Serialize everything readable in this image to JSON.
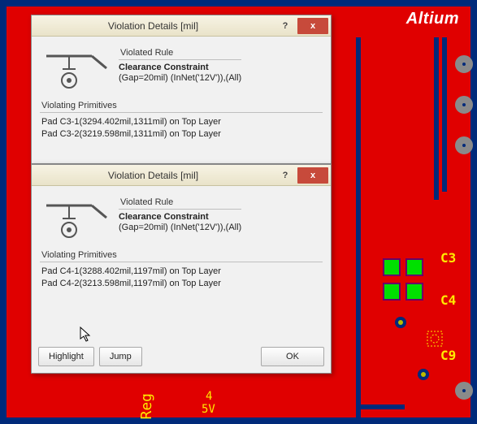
{
  "brand": "Altium",
  "pcb": {
    "refdes": [
      "C3",
      "C4",
      "C9"
    ],
    "net_label_top": "4",
    "net_label_bot": "5V",
    "reg_text": "Reg"
  },
  "dialog1": {
    "title": "Violation Details [mil]",
    "help": "?",
    "close": "x",
    "violated_rule_heading": "Violated Rule",
    "rule_name": "Clearance Constraint",
    "rule_expr": "(Gap=20mil) (InNet('12V')),(All)",
    "violating_primitives_heading": "Violating Primitives",
    "primitives": [
      "Pad C3-1(3294.402mil,1311mil) on Top Layer",
      "Pad C3-2(3219.598mil,1311mil) on Top Layer"
    ]
  },
  "dialog2": {
    "title": "Violation Details [mil]",
    "help": "?",
    "close": "x",
    "violated_rule_heading": "Violated Rule",
    "rule_name": "Clearance Constraint",
    "rule_expr": "(Gap=20mil) (InNet('12V')),(All)",
    "violating_primitives_heading": "Violating Primitives",
    "primitives": [
      "Pad C4-1(3288.402mil,1197mil) on Top Layer",
      "Pad C4-2(3213.598mil,1197mil) on Top Layer"
    ],
    "buttons": {
      "highlight": "Highlight",
      "jump": "Jump",
      "ok": "OK"
    }
  }
}
